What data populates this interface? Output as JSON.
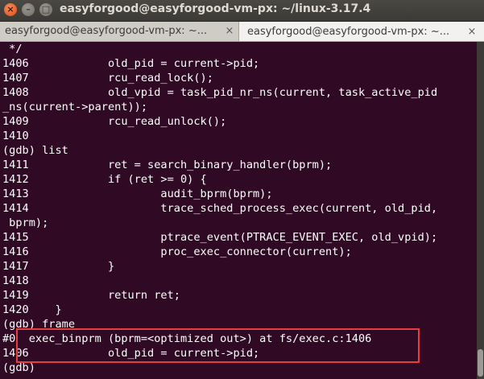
{
  "window": {
    "title": "easyforgood@easyforgood-vm-px: ~/linux-3.17.4",
    "buttons": {
      "close_icon": "close-icon",
      "minimize_icon": "minimize-icon",
      "maximize_icon": "maximize-icon"
    }
  },
  "tabs": [
    {
      "label": "easyforgood@easyforgood-vm-px: ~...",
      "close": "×",
      "active": false
    },
    {
      "label": "easyforgood@easyforgood-vm-px: ~...",
      "close": "×",
      "active": true
    }
  ],
  "terminal": {
    "lines": [
      " */",
      "1406            old_pid = current->pid;",
      "1407            rcu_read_lock();",
      "1408            old_vpid = task_pid_nr_ns(current, task_active_pid",
      "_ns(current->parent));",
      "1409            rcu_read_unlock();",
      "1410",
      "(gdb) list",
      "1411            ret = search_binary_handler(bprm);",
      "1412            if (ret >= 0) {",
      "1413                    audit_bprm(bprm);",
      "1414                    trace_sched_process_exec(current, old_pid,",
      " bprm);",
      "1415                    ptrace_event(PTRACE_EVENT_EXEC, old_vpid);",
      "1416                    proc_exec_connector(current);",
      "1417            }",
      "1418",
      "1419            return ret;",
      "1420    }",
      "(gdb) frame",
      "#0  exec_binprm (bprm=<optimized out>) at fs/exec.c:1406",
      "1406            old_pid = current->pid;",
      "(gdb)"
    ],
    "colors": {
      "background": "#300a24",
      "foreground": "#ffffff",
      "highlight_border": "#e53e3e"
    }
  }
}
